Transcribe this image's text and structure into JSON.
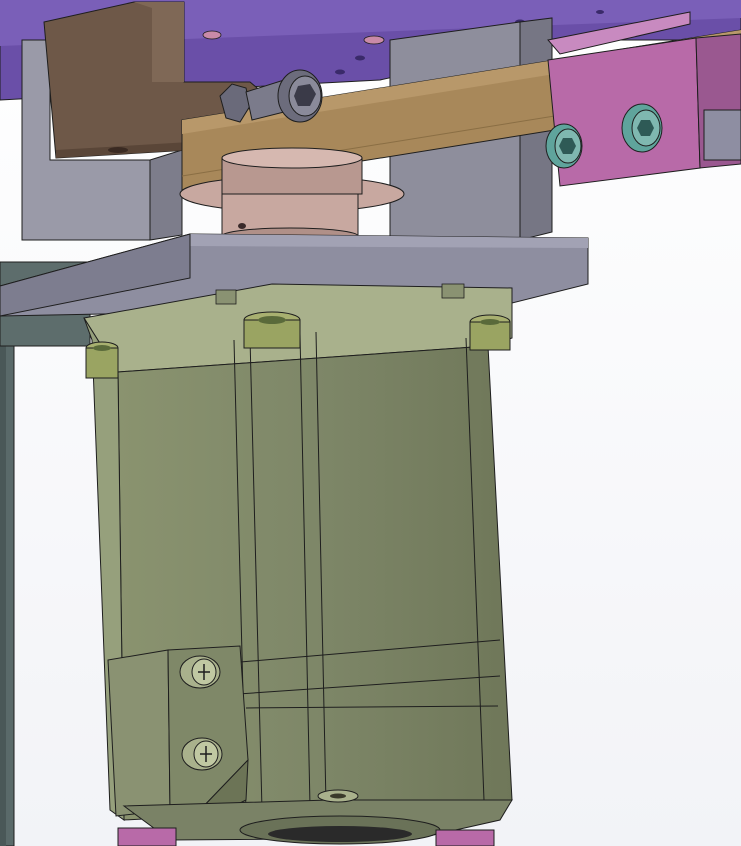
{
  "colors": {
    "background_top": "#ffffff",
    "background_bottom": "#f2f3f7",
    "purple_plate": "#6a4fa8",
    "brown_block": "#6e5848",
    "tan_belt": "#a8885a",
    "pink_clamp": "#b86aa8",
    "gray_frame": "#8a8a96",
    "motor_body": "#7f8868",
    "motor_highlight": "#a9b18c",
    "yellow_green_spacer": "#a8b070",
    "teal_screw": "#7fb8b0",
    "pulley": "#c8a8a0",
    "edge_line": "#1e1e1e"
  },
  "icons": {
    "hex_bolt": "hex-bolt-icon",
    "cap_screw": "socket-cap-screw-icon",
    "phillips_screw": "phillips-screw-icon"
  }
}
